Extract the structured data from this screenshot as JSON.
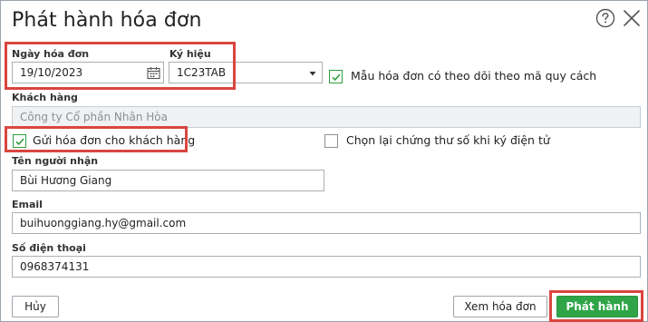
{
  "dialog": {
    "title": "Phát hành hóa đơn"
  },
  "invoice": {
    "date_label": "Ngày hóa đơn",
    "date_value": "19/10/2023",
    "symbol_label": "Ký hiệu",
    "symbol_value": "1C23TAB",
    "template_tracking_label": "Mẫu hóa đơn có theo dõi theo mã quy cách",
    "template_tracking_checked": true
  },
  "customer": {
    "label": "Khách hàng",
    "value": "Công ty Cổ phần Nhân Hòa"
  },
  "send_to_customer": {
    "label": "Gửi hóa đơn cho khách hàng",
    "checked": true
  },
  "reselect_cert": {
    "label": "Chọn lại chứng thư số khi ký điện tử",
    "checked": false
  },
  "recipient": {
    "label": "Tên người nhận",
    "value": "Bùi Hương Giang"
  },
  "email": {
    "label": "Email",
    "value": "buihuonggiang.hy@gmail.com"
  },
  "phone": {
    "label": "Số điện thoại",
    "value": "0968374131"
  },
  "footer": {
    "cancel_label": "Hủy",
    "preview_label": "Xem hóa đơn",
    "publish_label": "Phát hành"
  },
  "colors": {
    "accent_green": "#2fa548",
    "highlight_red": "#d9463f",
    "check_green": "#2e9e3e"
  },
  "icons": {
    "help": "help-icon",
    "close": "close-icon",
    "calendar": "calendar-icon",
    "dropdown": "chevron-down-icon",
    "check": "checkmark-icon"
  }
}
